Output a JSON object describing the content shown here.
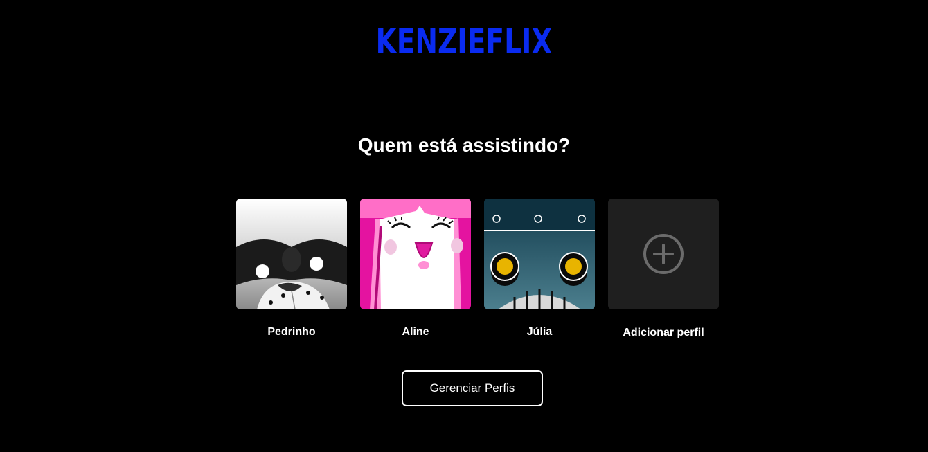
{
  "brand": {
    "logo_text": "KENZIEFLIX",
    "logo_color": "#0a2bf0"
  },
  "heading": "Quem está assistindo?",
  "profiles": [
    {
      "name": "Pedrinho",
      "avatar_icon": "panda-avatar-icon"
    },
    {
      "name": "Aline",
      "avatar_icon": "pink-smile-avatar-icon"
    },
    {
      "name": "Júlia",
      "avatar_icon": "robot-avatar-icon"
    }
  ],
  "add_profile": {
    "label": "Adicionar perfil",
    "icon": "plus-circle-icon"
  },
  "manage_button": {
    "label": "Gerenciar Perfis"
  },
  "colors": {
    "background": "#000000",
    "text": "#ffffff",
    "add_tile": "#1f1f1f",
    "pink_avatar": "#e413a0",
    "teal_avatar": "#1a4a5c"
  }
}
